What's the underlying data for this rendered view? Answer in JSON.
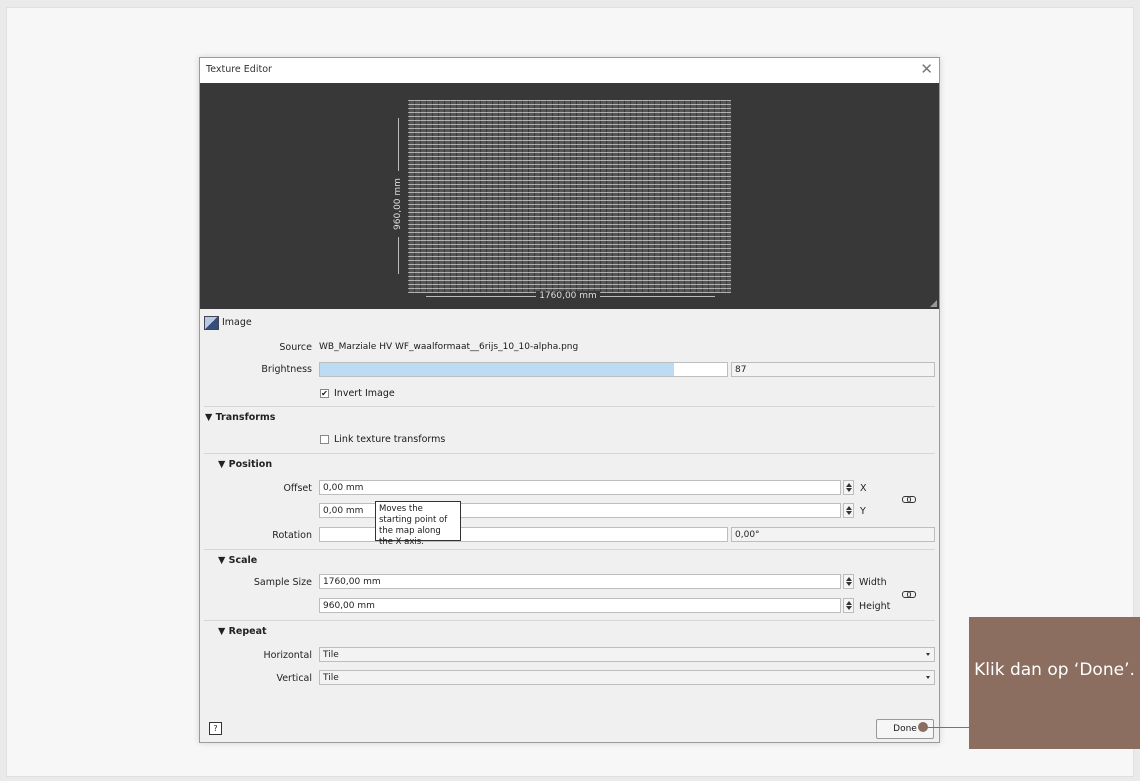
{
  "dialog": {
    "title": "Texture Editor",
    "close_glyph": "✕",
    "preview": {
      "height_label": "960,00 mm",
      "width_label": "1760,00 mm"
    },
    "image_section": {
      "label": "Image",
      "source_label": "Source",
      "source_value": "WB_Marziale HV WF_waalformaat__6rijs_10_10-alpha.png",
      "brightness_label": "Brightness",
      "brightness_value": "87",
      "brightness_percent": 87,
      "invert_label": "Invert Image",
      "invert_checked": true
    },
    "transforms": {
      "label": "▼ Transforms",
      "link_label": "Link texture transforms",
      "link_checked": false
    },
    "position": {
      "label": "▼ Position",
      "offset_label": "Offset",
      "offset_x": "0,00 mm",
      "offset_y": "0,00 mm",
      "x_label": "X",
      "y_label": "Y",
      "rotation_label": "Rotation",
      "rotation_value": "0,00°"
    },
    "tooltip": "Moves the starting point of the map along the X axis.",
    "scale": {
      "label": "▼ Scale",
      "sample_size_label": "Sample Size",
      "width_value": "1760,00 mm",
      "height_value": "960,00 mm",
      "width_label": "Width",
      "height_label": "Height"
    },
    "repeat": {
      "label": "▼ Repeat",
      "horizontal_label": "Horizontal",
      "horizontal_value": "Tile",
      "vertical_label": "Vertical",
      "vertical_value": "Tile"
    },
    "help_label": "?",
    "done_label": "Done"
  },
  "callout": {
    "text": "Klik dan op ‘Done’.",
    "color": "#8b6e5f"
  }
}
